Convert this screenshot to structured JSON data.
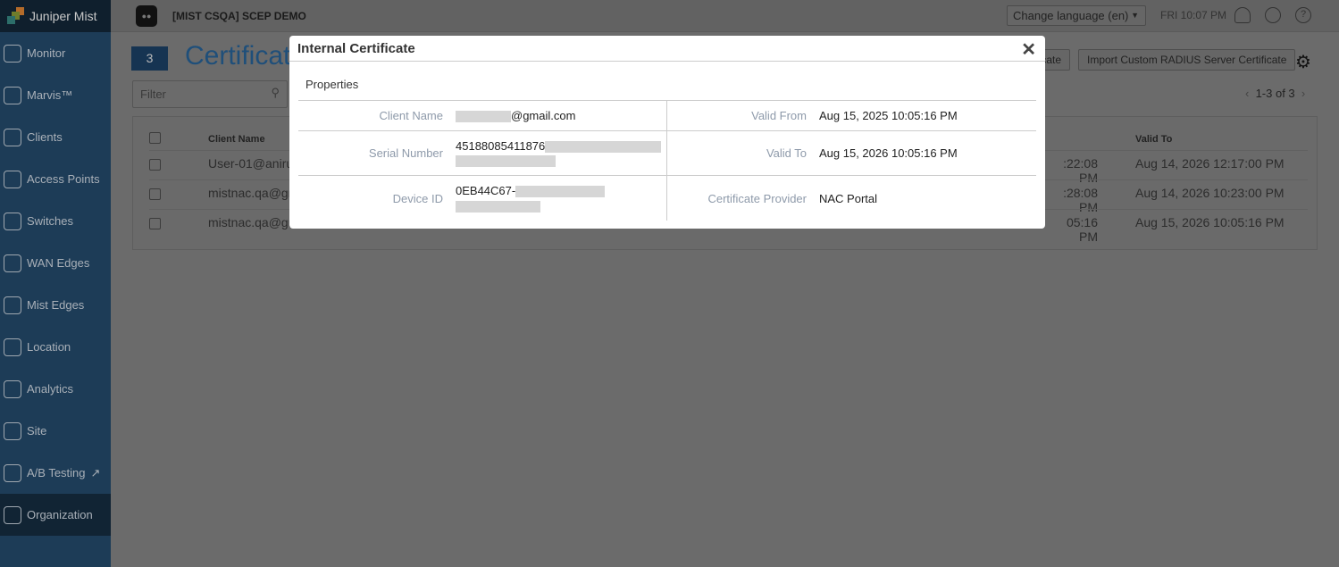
{
  "app": {
    "brand": "Juniper Mist",
    "org_name": "[MIST CSQA] SCEP DEMO",
    "language": "Change language (en)",
    "time": "FRI 10:07 PM"
  },
  "sidebar": {
    "items": [
      {
        "label": "Monitor",
        "icon": "monitor-icon"
      },
      {
        "label": "Marvis™",
        "icon": "marvis-icon"
      },
      {
        "label": "Clients",
        "icon": "clients-icon"
      },
      {
        "label": "Access Points",
        "icon": "access-points-icon"
      },
      {
        "label": "Switches",
        "icon": "switches-icon"
      },
      {
        "label": "WAN Edges",
        "icon": "wan-edges-icon"
      },
      {
        "label": "Mist Edges",
        "icon": "mist-edges-icon"
      },
      {
        "label": "Location",
        "icon": "location-icon"
      },
      {
        "label": "Analytics",
        "icon": "analytics-icon"
      },
      {
        "label": "Site",
        "icon": "site-icon"
      },
      {
        "label": "A/B Testing",
        "icon": "ab-testing-icon"
      },
      {
        "label": "Organization",
        "icon": "organization-icon"
      }
    ]
  },
  "page": {
    "count": "3",
    "title": "Certificates",
    "filter_placeholder": "Filter",
    "btn_partial": "cate",
    "btn_import": "Import Custom RADIUS Server Certificate",
    "pager": "1-3 of 3"
  },
  "table": {
    "headers": {
      "client_name": "Client Name",
      "valid_to": "Valid To"
    },
    "rows": [
      {
        "client": "User-01@aniru",
        "valid_from_tail": ":22:08 PM",
        "valid_to": "Aug 14, 2026 12:17:00 PM"
      },
      {
        "client": "mistnac.qa@gm",
        "valid_from_tail": ":28:08 PM",
        "valid_to": "Aug 14, 2026 10:23:00 PM"
      },
      {
        "client": "mistnac.qa@gm",
        "valid_from_tail": "05:16 PM",
        "valid_to": "Aug 15, 2026 10:05:16 PM"
      }
    ]
  },
  "modal": {
    "title": "Internal Certificate",
    "section": "Properties",
    "client_name_label": "Client Name",
    "client_name": "@gmail.com",
    "serial_label": "Serial Number",
    "serial": "45188085411876",
    "device_label": "Device ID",
    "device": "0EB44C67-",
    "valid_from_label": "Valid From",
    "valid_from": "Aug 15, 2025 10:05:16 PM",
    "valid_to_label": "Valid To",
    "valid_to": "Aug 15, 2026 10:05:16 PM",
    "provider_label": "Certificate Provider",
    "provider": "NAC Portal"
  }
}
